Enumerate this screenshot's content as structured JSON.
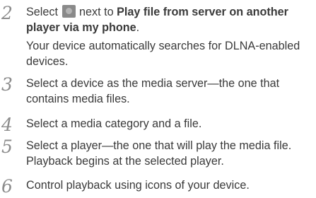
{
  "steps": [
    {
      "number": "2",
      "text_before": "Select ",
      "icon": "arrow-button-icon",
      "text_after": " next to ",
      "bold_1": "Play file from server on another",
      "bold_2": "player via my phone",
      "punct": ".",
      "sub_1": "Your device automatically searches for DLNA-enabled",
      "sub_2": "devices."
    },
    {
      "number": "3",
      "line_1": "Select a device as the media server—the one that",
      "line_2": "contains media files."
    },
    {
      "number": "4",
      "line_1": "Select a media category and a file."
    },
    {
      "number": "5",
      "line_1": "Select a player—the one that will play the media file.",
      "line_2": "Playback begins at the selected player."
    },
    {
      "number": "6",
      "line_1": "Control playback using icons of your device."
    }
  ]
}
